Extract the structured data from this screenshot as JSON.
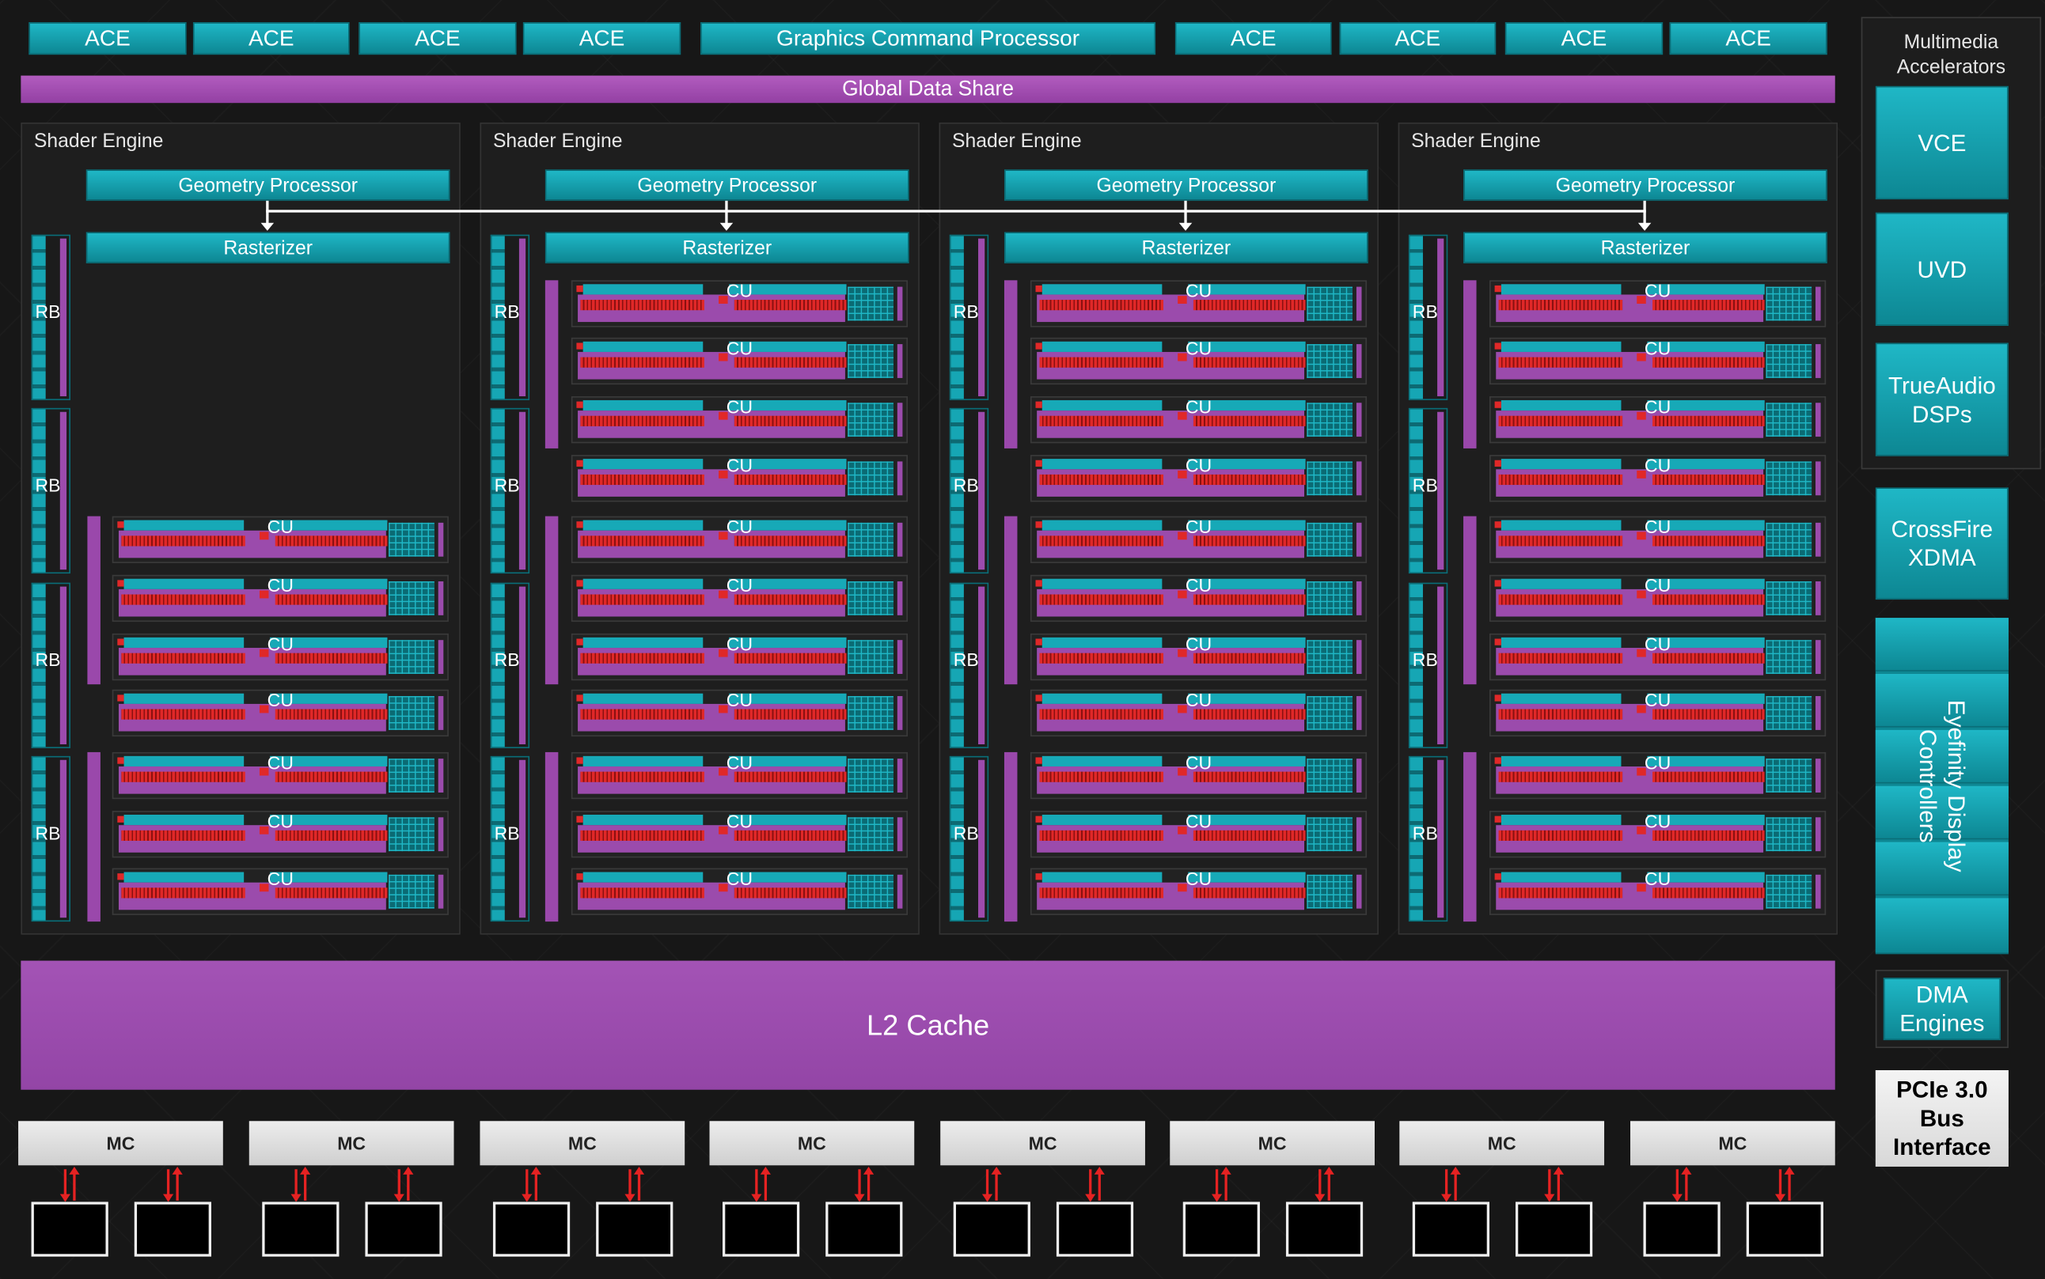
{
  "top_bar": {
    "ace_labels": [
      "ACE",
      "ACE",
      "ACE",
      "ACE",
      "ACE",
      "ACE",
      "ACE",
      "ACE"
    ],
    "command_processor": "Graphics Command Processor"
  },
  "global_data_share": "Global Data Share",
  "shader_engines": [
    {
      "title": "Shader Engine",
      "geometry_processor": "Geometry Processor",
      "rasterizer": "Rasterizer",
      "rb_label": "RB",
      "cu_label": "CU",
      "cu_count": 7
    },
    {
      "title": "Shader Engine",
      "geometry_processor": "Geometry Processor",
      "rasterizer": "Rasterizer",
      "rb_label": "RB",
      "cu_label": "CU",
      "cu_count": 11
    },
    {
      "title": "Shader Engine",
      "geometry_processor": "Geometry Processor",
      "rasterizer": "Rasterizer",
      "rb_label": "RB",
      "cu_label": "CU",
      "cu_count": 11
    },
    {
      "title": "Shader Engine",
      "geometry_processor": "Geometry Processor",
      "rasterizer": "Rasterizer",
      "rb_label": "RB",
      "cu_label": "CU",
      "cu_count": 11
    }
  ],
  "l2_cache": "L2 Cache",
  "memory_controllers": [
    "MC",
    "MC",
    "MC",
    "MC",
    "MC",
    "MC",
    "MC",
    "MC"
  ],
  "multimedia": {
    "title_line1": "Multimedia",
    "title_line2": "Accelerators",
    "vce": "VCE",
    "uvd": "UVD",
    "trueaudio_line1": "TrueAudio",
    "trueaudio_line2": "DSPs"
  },
  "crossfire_line1": "CrossFire",
  "crossfire_line2": "XDMA",
  "eyefinity_line1": "Eyefinity Display",
  "eyefinity_line2": "Controllers",
  "dma_line1": "DMA",
  "dma_line2": "Engines",
  "pcie_line1": "PCIe 3.0",
  "pcie_line2": "Bus",
  "pcie_line3": "Interface",
  "colors": {
    "teal": "#1fb7c6",
    "purple": "#9b4bac",
    "red": "#e02828",
    "background": "#171717"
  }
}
